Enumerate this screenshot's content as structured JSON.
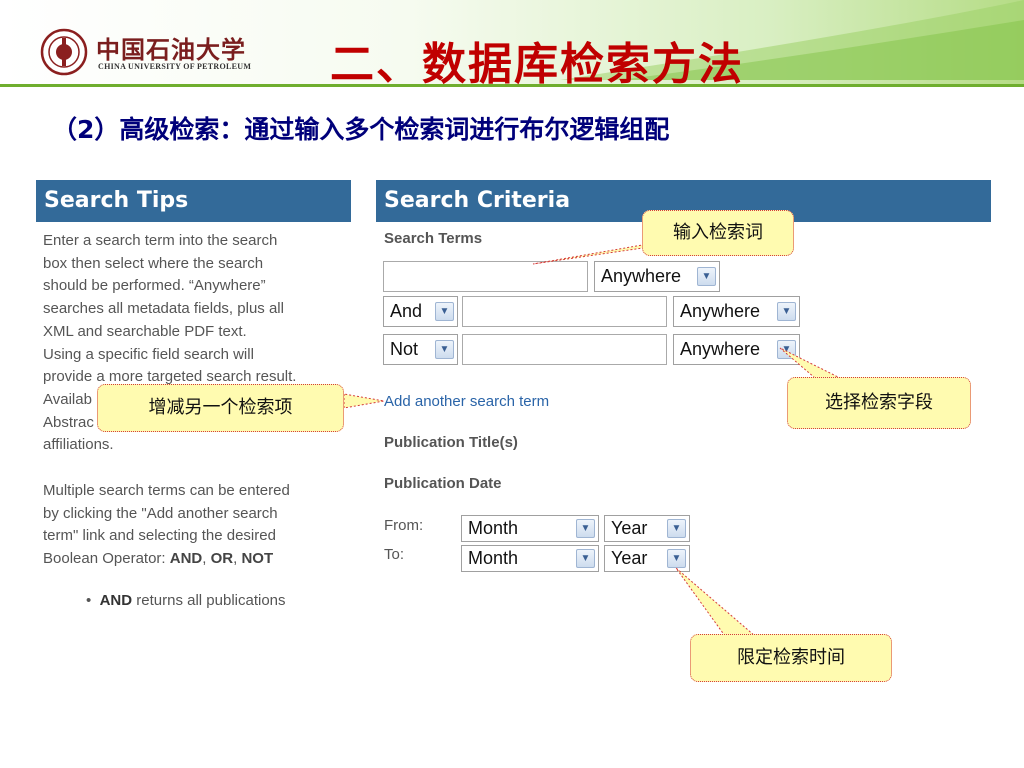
{
  "header": {
    "university_cn": "中国石油大学",
    "university_en": "CHINA UNIVERSITY OF PETROLEUM",
    "title": "二、数据库检索方法",
    "subtitle": "（2）高级检索：通过输入多个检索词进行布尔逻辑组配",
    "colors": {
      "title": "#c00000",
      "subtitle": "#00007a",
      "rule": "#6fae2e"
    }
  },
  "tips": {
    "heading": "Search Tips",
    "lines": [
      "Enter a search term into the search",
      "box then select where the search",
      "should be performed. “Anywhere”",
      "searches all metadata fields, plus all",
      "XML and searchable PDF text.",
      "Using a specific field search will",
      "provide a more targeted search result.",
      "Availab",
      "Abstrac",
      "affiliations."
    ],
    "multi_lines": [
      "Multiple search terms can be entered",
      "by clicking the \"Add another search",
      "term\" link and selecting the desired"
    ],
    "boolean_prefix": "Boolean Operator: ",
    "op_and": "AND",
    "op_or": "OR",
    "op_not": "NOT",
    "sep": ", ",
    "bullet_bold": "AND",
    "bullet_rest": " returns all publications"
  },
  "criteria": {
    "heading": "Search Criteria",
    "search_terms_label": "Search Terms",
    "row1": {
      "field": "Anywhere"
    },
    "row2": {
      "operator": "And",
      "field": "Anywhere"
    },
    "row3": {
      "operator": "Not",
      "field": "Anywhere"
    },
    "add_link": "Add another search term",
    "publication_title_label": "Publication Title(s)",
    "publication_date_label": "Publication Date",
    "from_label": "From:",
    "to_label": "To:",
    "from_month": "Month",
    "from_year": "Year",
    "to_month": "Month",
    "to_year": "Year",
    "dropdown_icon": "chevron-down-icon",
    "accent": "#336a99",
    "link_color": "#2a64a8"
  },
  "callouts": {
    "enter_terms": "输入检索词",
    "select_field": "选择检索字段",
    "add_remove": "增减另一个检索项",
    "limit_time": "限定检索时间"
  }
}
